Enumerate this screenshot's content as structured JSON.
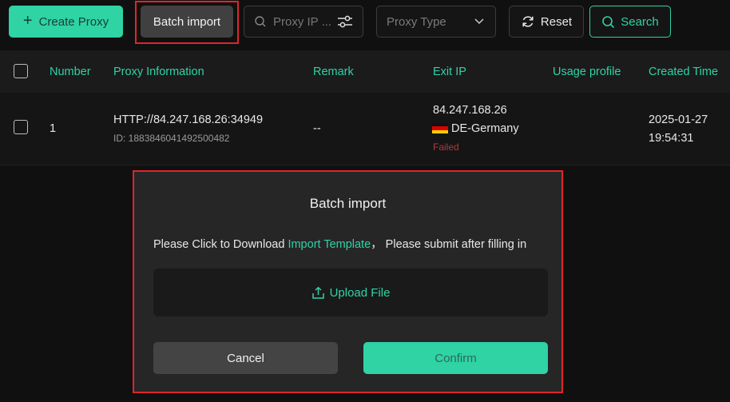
{
  "toolbar": {
    "create_label": "Create Proxy",
    "batch_label": "Batch import",
    "search_placeholder": "Proxy IP ...",
    "type_placeholder": "Proxy Type",
    "reset_label": "Reset",
    "search_label": "Search"
  },
  "table": {
    "headers": [
      "Number",
      "Proxy Information",
      "Remark",
      "Exit IP",
      "Usage profile",
      "Created Time"
    ],
    "rows": [
      {
        "number": "1",
        "proxy": "HTTP://84.247.168.26:34949",
        "id": "ID: 1883846041492500482",
        "remark": "--",
        "exit_ip": "84.247.168.26",
        "country": "DE-Germany",
        "status": "Failed",
        "created_date": "2025-01-27",
        "created_time": "19:54:31"
      }
    ]
  },
  "dialog": {
    "title": "Batch import",
    "message_prefix": "Please Click to Download ",
    "link": "Import Template",
    "message_suffix": "， Please submit after filling in",
    "upload_label": "Upload File",
    "cancel_label": "Cancel",
    "confirm_label": "Confirm"
  },
  "colors": {
    "accent": "#2fd3a4",
    "highlight": "#e0242c",
    "failed": "#b23a3a"
  },
  "icons": [
    "plus-icon",
    "search-icon",
    "filter-icon",
    "chevron-down-icon",
    "reset-icon",
    "upload-icon",
    "germany-flag-icon"
  ]
}
